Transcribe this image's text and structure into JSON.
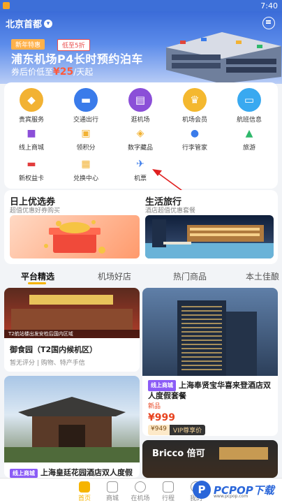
{
  "status": {
    "time": "7:40"
  },
  "header": {
    "city": "北京首都"
  },
  "banner": {
    "tag_new": "新年特惠",
    "tag_discount": "低至5折",
    "title": "浦东机场P4长时预约泊车",
    "sub_prefix": "券后价低至",
    "sub_price": "¥25",
    "sub_suffix": "/天起"
  },
  "services": [
    {
      "label": "贵宾服务",
      "icon": "diamond-icon",
      "color": "#f2b233"
    },
    {
      "label": "交通出行",
      "icon": "car-icon",
      "color": "#3a7bea"
    },
    {
      "label": "逛机场",
      "icon": "shop-icon",
      "color": "#8b4fd8"
    },
    {
      "label": "机场会员",
      "icon": "crown-icon",
      "color": "#f4b82f"
    },
    {
      "label": "航班信息",
      "icon": "ticket-icon",
      "color": "#39a9f0"
    }
  ],
  "shortcuts_row1": [
    {
      "label": "线上商城",
      "icon": "bag-icon",
      "color": "#8b4fd8"
    },
    {
      "label": "领积分",
      "icon": "gift-icon",
      "color": "#f2b233"
    },
    {
      "label": "数字藏品",
      "icon": "cube-icon",
      "color": "#f2b233"
    },
    {
      "label": "行李管家",
      "icon": "person-icon",
      "color": "#3a7bea"
    },
    {
      "label": "旅游",
      "icon": "mountain-icon",
      "color": "#2fb86b"
    }
  ],
  "shortcuts_row2": [
    {
      "label": "新权益卡",
      "icon": "card-icon",
      "color": "#e23c3c"
    },
    {
      "label": "兑换中心",
      "icon": "exchange-icon",
      "color": "#f2b233"
    },
    {
      "label": "机票",
      "icon": "airplane-icon",
      "color": "#3a7bea"
    }
  ],
  "promo": {
    "left_title": "日上优选券",
    "left_sub": "超值优惠好券购买",
    "right_title": "生活旅行",
    "right_sub": "酒店超值优惠套餐"
  },
  "tabs": [
    "平台精选",
    "机场好店",
    "热门商品",
    "本土佳酿"
  ],
  "feed": [
    {
      "title": "御食园（T2国内候机区）",
      "meta": "暂无评分 | 购物、特产手信",
      "image_caption": "T2航站楼出发安检后国内区域"
    },
    {
      "badge": "线上商城",
      "title": "上海奉贤宝华喜来登酒店双人度假套餐",
      "meta": "新品",
      "price": "¥999",
      "vip_price": "¥949",
      "vip_label": "VIP尊享价"
    },
    {
      "badge": "线上商城",
      "title": "上海皇廷花园酒店双人度假套餐"
    },
    {
      "title": "Bricco 倍可"
    }
  ],
  "nav": [
    "首页",
    "商城",
    "在机场",
    "行程",
    "我的"
  ],
  "watermark": {
    "brand": "PCPOP下载",
    "url": "www.pcpop.com"
  }
}
